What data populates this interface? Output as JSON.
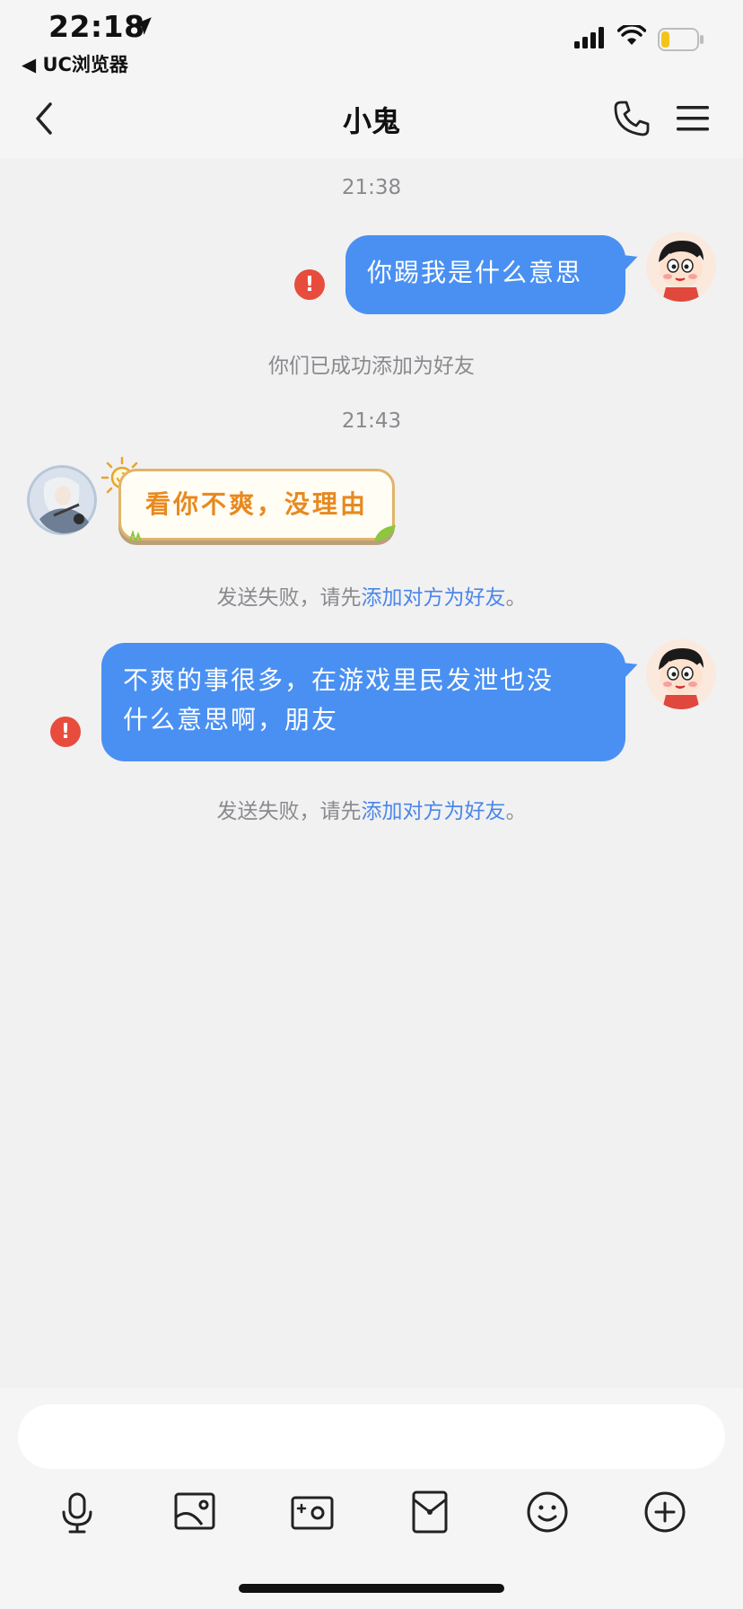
{
  "status_bar": {
    "time": "22:18",
    "back_app": "◀ UC浏览器"
  },
  "nav": {
    "title": "小鬼"
  },
  "messages": {
    "time1": "21:38",
    "msg1": "你踢我是什么意思",
    "friend_added": "你们已成功添加为好友",
    "time2": "21:43",
    "sticker_text": "看你不爽，没理由",
    "fail1_prefix": "发送失败，请先",
    "fail1_link": "添加对方为好友",
    "fail1_suffix": "。",
    "msg2_line1": "不爽的事很多，在游戏里民发泄也没",
    "msg2_line2": "什么意思啊，朋友",
    "fail2_prefix": "发送失败，请先",
    "fail2_link": "添加对方为好友",
    "fail2_suffix": "。",
    "error_glyph": "!"
  },
  "toolbar": {
    "icons": [
      "microphone-icon",
      "image-icon",
      "camera-icon",
      "red-packet-icon",
      "emoji-icon",
      "plus-icon"
    ]
  },
  "colors": {
    "bubble": "#4a90f2",
    "error": "#e74c3c",
    "link": "#4a86e8"
  }
}
